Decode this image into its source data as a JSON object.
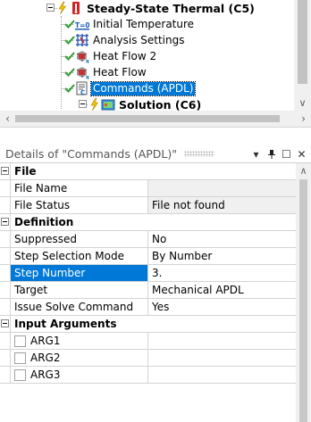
{
  "tree": {
    "nodes": [
      {
        "label": "Steady-State Thermal (C5)",
        "icon": "thermal-analysis-icon"
      },
      {
        "label": "Initial Temperature",
        "icon": "initial-temperature-icon"
      },
      {
        "label": "Analysis Settings",
        "icon": "analysis-settings-icon"
      },
      {
        "label": "Heat Flow 2",
        "icon": "heat-flow-icon"
      },
      {
        "label": "Heat Flow",
        "icon": "heat-flow-icon"
      },
      {
        "label": "Commands (APDL)",
        "icon": "commands-apdl-icon"
      },
      {
        "label": "Solution (C6)",
        "icon": "solution-icon"
      }
    ],
    "initial_temp_glyph": "T=0",
    "colors": {
      "selection": "#0078d7",
      "check": "#2e9b2e",
      "lightning": "#f2c200",
      "thermal": "#d42020"
    }
  },
  "details": {
    "title": "Details of \"Commands (APDL)\"",
    "buttons": {
      "dropdown": "▾",
      "pin": "⊥",
      "restore": "☐",
      "close": "✕"
    },
    "sections": [
      {
        "name": "File",
        "rows": [
          {
            "name": "File Name",
            "value": ""
          },
          {
            "name": "File Status",
            "value": "File not found"
          }
        ]
      },
      {
        "name": "Definition",
        "rows": [
          {
            "name": "Suppressed",
            "value": "No"
          },
          {
            "name": "Step Selection Mode",
            "value": "By Number"
          },
          {
            "name": "Step Number",
            "value": "3."
          },
          {
            "name": "Target",
            "value": "Mechanical APDL"
          },
          {
            "name": "Issue Solve Command",
            "value": "Yes"
          }
        ]
      },
      {
        "name": "Input Arguments",
        "rows": [
          {
            "name": "ARG1",
            "value": ""
          },
          {
            "name": "ARG2",
            "value": ""
          },
          {
            "name": "ARG3",
            "value": ""
          }
        ]
      }
    ]
  }
}
